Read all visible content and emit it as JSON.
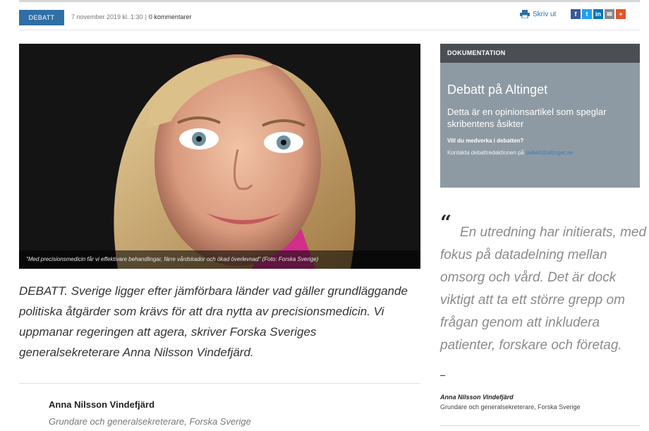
{
  "meta": {
    "category": "DEBATT",
    "date": "7 november 2019 kl. 1:30",
    "separator": "|",
    "comments": "0 kommentarer",
    "print_label": "Skriv ut"
  },
  "social": [
    "f",
    "t",
    "in",
    "✉",
    "+"
  ],
  "hero": {
    "caption": "\"Med precisionsmedicin får vi effektivare behandlingar, färre vårdskador och ökad överlevnad\" (Foto: Forska Sverige)"
  },
  "article": {
    "lead": "DEBATT. Sverige ligger efter jämförbara länder vad gäller grundläggande politiska åtgärder som krävs för att dra nytta av precisionsmedicin. Vi uppmanar regeringen att agera, skriver Forska Sveriges generalsekreterare Anna Nilsson Vindefjärd.",
    "author_name": "Anna Nilsson Vindefjärd",
    "author_title": "Grundare och generalsekreterare, Forska Sverige"
  },
  "documentation": {
    "header": "DOKUMENTATION",
    "title": "Debatt på Altinget",
    "subtitle": "Detta är en opinionsartikel som speglar skribentens åsikter",
    "question": "Vill du medverka i debatten?",
    "contact_text": "Kontakta debattredaktionen på ",
    "contact_email": "debatt@altinget.se"
  },
  "pullquote": {
    "mark": "“",
    "text": "En utredning har initierats, med fokus på datadelning mellan omsorg och vård. Det är dock viktigt att ta ett större grepp om frågan genom att inkludera patienter, forskare och företag.",
    "author": "Anna Nilsson Vindefjärd",
    "role": "Grundare och generalsekreterare, Forska Sverige"
  },
  "colors": {
    "brand_blue": "#2f6fa6",
    "doc_box": "#8e9aa3",
    "doc_head": "#4b4f54",
    "facebook": "#3b5998",
    "twitter": "#1da1f2",
    "linkedin": "#0077b5",
    "mail": "#888888",
    "plus": "#e0532b"
  }
}
